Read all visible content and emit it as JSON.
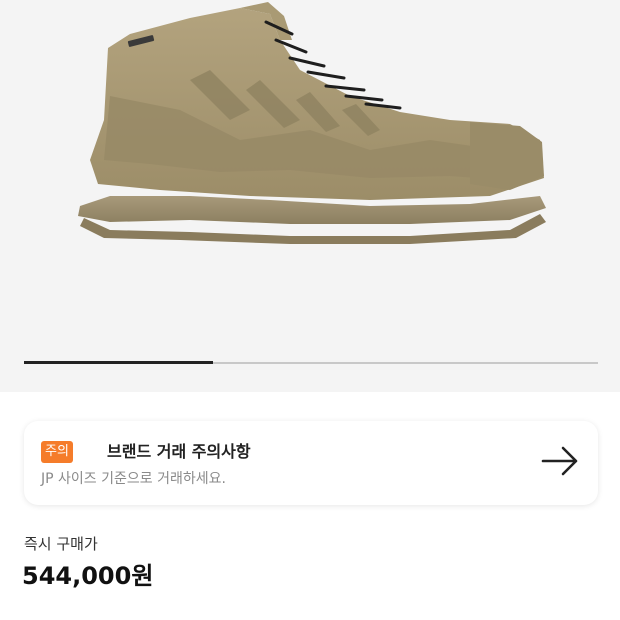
{
  "gallery": {
    "image_icon": "hiking-boot-image",
    "progress": 0.33,
    "background_color": "#f4f4f4"
  },
  "notice": {
    "badge": "주의",
    "badge_color": "#f57c2a",
    "title": "브랜드 거래 주의사항",
    "subtitle": "JP 사이즈 기준으로 거래하세요.",
    "arrow_icon": "arrow-right-icon"
  },
  "price": {
    "label": "즉시 구매가",
    "value": "544,000원"
  }
}
